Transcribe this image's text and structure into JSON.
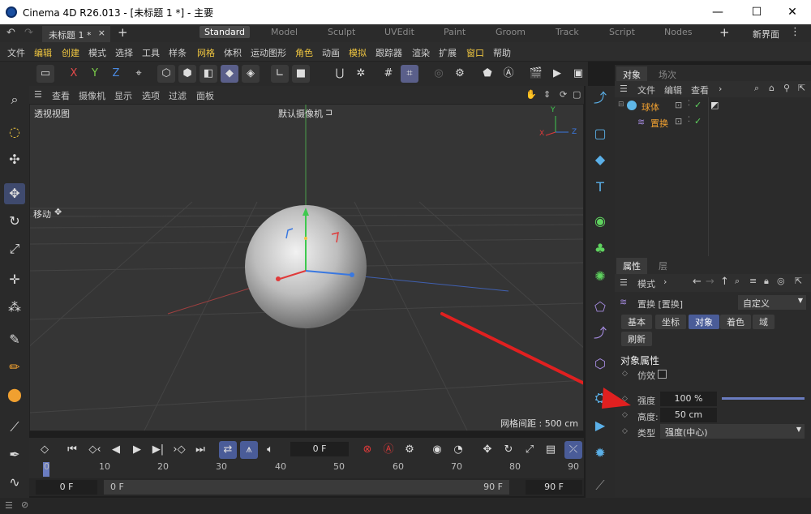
{
  "window": {
    "title": "Cinema 4D R26.013 - [未标题 1 *] - 主要",
    "minimize": "—",
    "maximize": "☐",
    "close": "✕"
  },
  "tabs": {
    "document": "未标题 1 *",
    "doc_close": "×",
    "add": "+",
    "layouts": [
      "Standard",
      "Model",
      "Sculpt",
      "UVEdit",
      "Paint",
      "Groom",
      "Track",
      "Script",
      "Nodes"
    ],
    "active_layout": "Standard",
    "add_layout": "+",
    "new_ui": "新界面"
  },
  "menubar": [
    "文件",
    "编辑",
    "创建",
    "模式",
    "选择",
    "工具",
    "样条",
    "网格",
    "体积",
    "运动图形",
    "角色",
    "动画",
    "模拟",
    "跟踪器",
    "渲染",
    "扩展",
    "窗口",
    "帮助"
  ],
  "toolbar": {
    "x": "X",
    "y": "Y",
    "z": "Z"
  },
  "viewport": {
    "menu": [
      "查看",
      "摄像机",
      "显示",
      "选项",
      "过滤",
      "面板"
    ],
    "view_name": "透视视图",
    "camera": "默认摄像机",
    "tool_label": "移动",
    "grid_spacing": "网格间距 : 500 cm",
    "axis_y": "Y",
    "axis_x": "X",
    "axis_z": "Z"
  },
  "object_manager": {
    "tabs": [
      "对象",
      "场次"
    ],
    "menu": [
      "文件",
      "编辑",
      "查看"
    ],
    "objects": [
      {
        "name": "球体",
        "color": "#f0a030"
      },
      {
        "name": "置换",
        "color": "#f0a030"
      }
    ]
  },
  "attribute_manager": {
    "tabs": [
      "属性",
      "层"
    ],
    "mode_label": "模式",
    "object_title": "置换 [置换]",
    "preset": "自定义",
    "tab_buttons": [
      "基本",
      "坐标",
      "对象",
      "着色",
      "域",
      "刷新"
    ],
    "active_tab": "对象",
    "section_title": "对象属性",
    "fields": {
      "imitate_label": "仿效",
      "strength_label": "强度",
      "strength_value": "100 %",
      "strength_fraction": 1.0,
      "height_label": "高度:",
      "height_value": "50 cm",
      "type_label": "类型",
      "type_value": "强度(中心)"
    }
  },
  "timeline": {
    "current_frame": "0 F",
    "ticks": [
      "0",
      "10",
      "20",
      "30",
      "40",
      "50",
      "60",
      "70",
      "80",
      "90"
    ],
    "start_frame": "0 F",
    "range_start": "0 F",
    "range_end": "90 F",
    "end_frame": "90 F"
  },
  "colors": {
    "accent": "#4a5c98",
    "highlight_menu": "#f0c640",
    "annotation_arrow": "#e02020"
  }
}
